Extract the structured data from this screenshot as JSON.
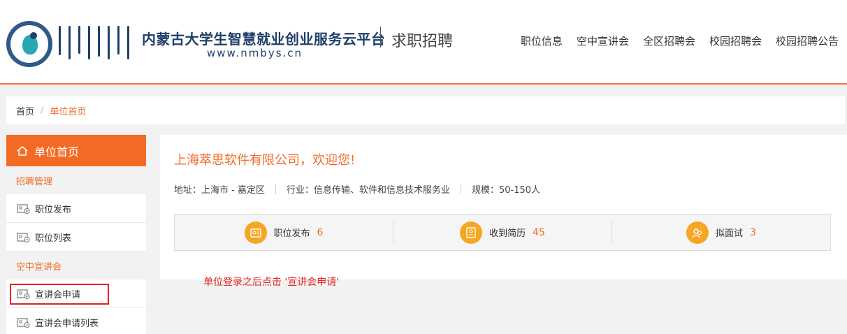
{
  "header": {
    "site_title": "内蒙古大学生智慧就业创业服务云平台",
    "site_url": "www.nmbys.cn",
    "section": "求职招聘",
    "nav": [
      "职位信息",
      "空中宣讲会",
      "全区招聘会",
      "校园招聘会",
      "校园招聘公告"
    ]
  },
  "breadcrumb": {
    "home": "首页",
    "separator": "/",
    "current": "单位首页"
  },
  "sidebar": {
    "head": "单位首页",
    "groups": [
      {
        "label": "招聘管理",
        "items": [
          "职位发布",
          "职位列表"
        ]
      },
      {
        "label": "空中宣讲会",
        "items": [
          "宣讲会申请",
          "宣讲会申请列表"
        ]
      }
    ]
  },
  "main": {
    "welcome": "上海萃思软件有限公司，欢迎您!",
    "address": "地址：上海市 - 嘉定区",
    "industry": "行业：信息传输、软件和信息技术服务业",
    "scale": "规模：50-150人",
    "stats": [
      {
        "label": "职位发布",
        "value": "6",
        "icon": "briefcase-icon"
      },
      {
        "label": "收到简历",
        "value": "45",
        "icon": "resume-icon"
      },
      {
        "label": "拟面试",
        "value": "3",
        "icon": "interview-icon"
      }
    ]
  },
  "annotation": "单位登录之后点击 '宣讲会申请'",
  "colors": {
    "accent": "#f36a25",
    "navy": "#1f3f6a",
    "highlight": "#e02424",
    "stat_icon": "#f5a623"
  }
}
